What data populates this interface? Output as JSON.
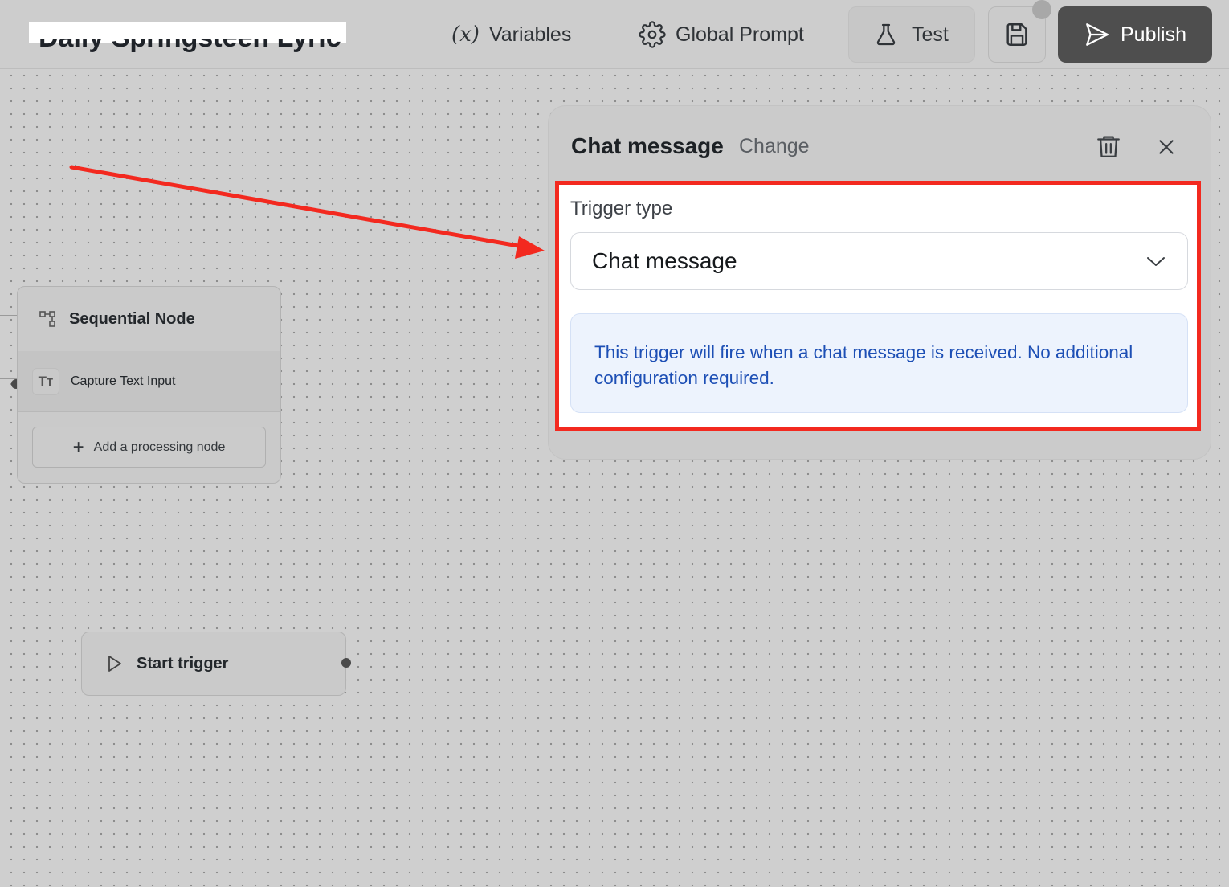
{
  "topbar": {
    "title": "Daily Springsteen Lyric",
    "variables_label": "Variables",
    "variables_glyph": "(x)",
    "global_prompt_label": "Global Prompt",
    "test_label": "Test",
    "publish_label": "Publish"
  },
  "canvas": {
    "sequential_node": {
      "title": "Sequential Node",
      "step_label": "Capture Text Input",
      "step_icon_text": "Tт",
      "add_label": "Add a processing node"
    },
    "start_node": {
      "label": "Start trigger"
    }
  },
  "panel": {
    "title": "Chat message",
    "change_label": "Change",
    "trigger_type_label": "Trigger type",
    "trigger_type_value": "Chat message",
    "info_text": "This trigger will fire when a chat message is received. No additional configuration required."
  },
  "annotation": {
    "highlight_color": "#f3291f",
    "arrow_color": "#f3291f"
  },
  "icons": [
    "variables-icon",
    "gear-icon",
    "flask-icon",
    "save-icon",
    "send-icon",
    "trash-icon",
    "close-icon",
    "chevron-down-icon",
    "sequential-icon",
    "text-icon",
    "plus-icon",
    "play-icon"
  ]
}
